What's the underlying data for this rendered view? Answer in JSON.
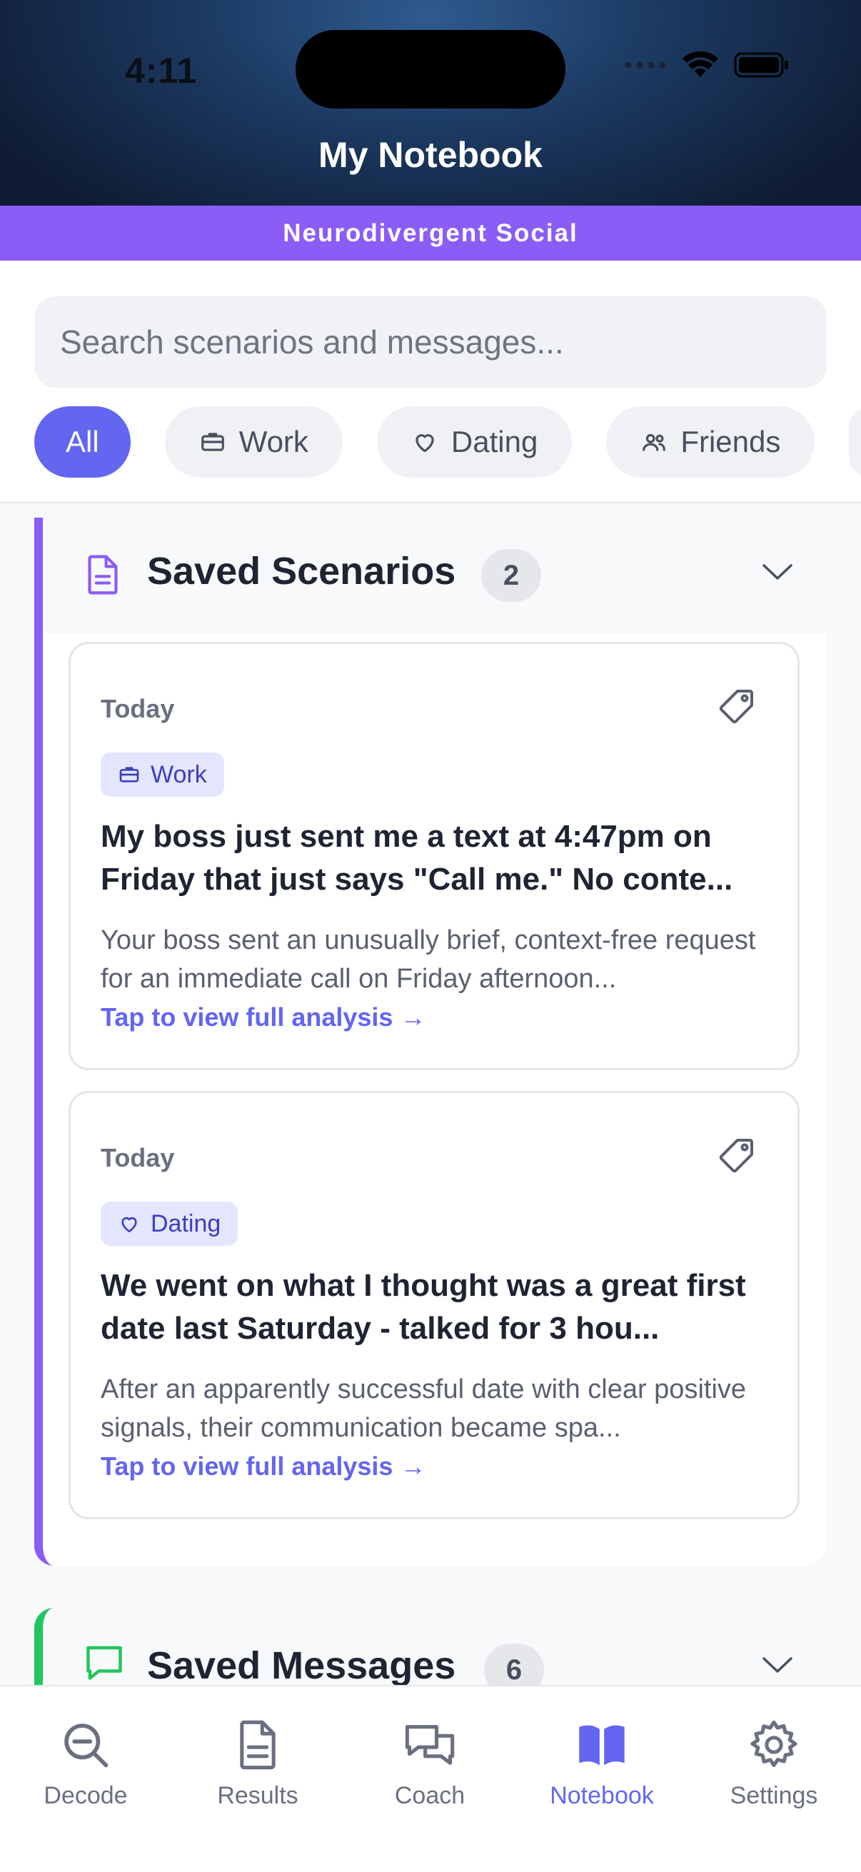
{
  "status_bar": {
    "time": "4:11"
  },
  "header": {
    "title": "My Notebook",
    "banner": "Neurodivergent Social"
  },
  "search": {
    "placeholder": "Search scenarios and messages..."
  },
  "filters": [
    {
      "label": "All",
      "icon": "none",
      "active": true
    },
    {
      "label": "Work",
      "icon": "briefcase-icon",
      "active": false
    },
    {
      "label": "Dating",
      "icon": "heart-icon",
      "active": false
    },
    {
      "label": "Friends",
      "icon": "people-icon",
      "active": false
    }
  ],
  "saved_scenarios": {
    "title": "Saved Scenarios",
    "count": "2",
    "items": [
      {
        "date": "Today",
        "category": "Work",
        "title": "My boss just sent me a text at 4:47pm on Friday that just says \"Call me.\" No conte...",
        "summary": "Your boss sent an unusually brief, context-free request for an immediate call on Friday afternoon...",
        "link": "Tap to view full analysis →"
      },
      {
        "date": "Today",
        "category": "Dating",
        "title": "We went on what I thought was a great first date last Saturday - talked for 3 hou...",
        "summary": "After an apparently successful date with clear positive signals, their communication became spa...",
        "link": "Tap to view full analysis →"
      }
    ]
  },
  "saved_messages": {
    "title": "Saved Messages",
    "count": "6"
  },
  "tabs": [
    {
      "label": "Decode",
      "icon": "search-icon"
    },
    {
      "label": "Results",
      "icon": "document-icon"
    },
    {
      "label": "Coach",
      "icon": "chat-icon"
    },
    {
      "label": "Notebook",
      "icon": "book-icon",
      "active": true
    },
    {
      "label": "Settings",
      "icon": "gear-icon"
    }
  ],
  "colors": {
    "accent": "#6366f1",
    "banner": "#8b5cf6",
    "scenarios_bar": "#8b5cf6",
    "messages_bar": "#22c55e"
  }
}
